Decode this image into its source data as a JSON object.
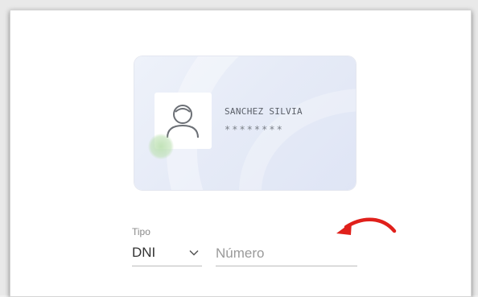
{
  "card": {
    "name": "SANCHEZ SILVIA",
    "document_masked": "********"
  },
  "form": {
    "tipo_label": "Tipo",
    "tipo_value": "DNI",
    "numero_placeholder": "Número"
  },
  "colors": {
    "arrow": "#e0201b",
    "card_background": "#e6ebf7"
  },
  "icons": {
    "avatar": "user-avatar-icon",
    "select": "chevron-down-icon",
    "annotation": "curved-arrow-icon"
  }
}
